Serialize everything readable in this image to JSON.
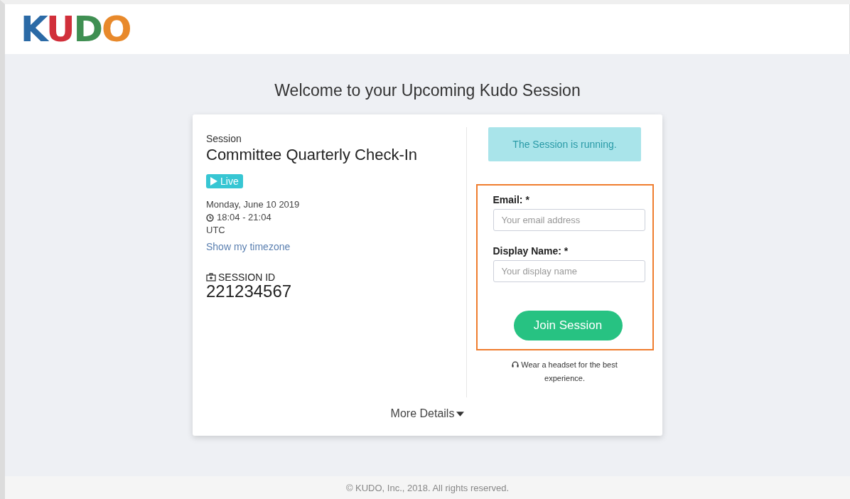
{
  "logo": "KUDO",
  "heading": "Welcome to your Upcoming Kudo Session",
  "session": {
    "label": "Session",
    "title": "Committee Quarterly Check-In",
    "status": "Live",
    "date": "Monday, June 10 2019",
    "time": "18:04 - 21:04",
    "timezone": "UTC",
    "timezone_link": "Show my timezone",
    "id_label": "SESSION ID",
    "id": "221234567"
  },
  "notice": "The Session is running.",
  "form": {
    "fields": [
      {
        "label": "Email: *",
        "placeholder": "Your email address"
      },
      {
        "label": "Display Name: *",
        "placeholder": "Your display name"
      }
    ],
    "button": "Join Session"
  },
  "tip": "Wear a headset for the best experience.",
  "more_details": "More Details",
  "footer": "© KUDO, Inc., 2018. All rights reserved."
}
